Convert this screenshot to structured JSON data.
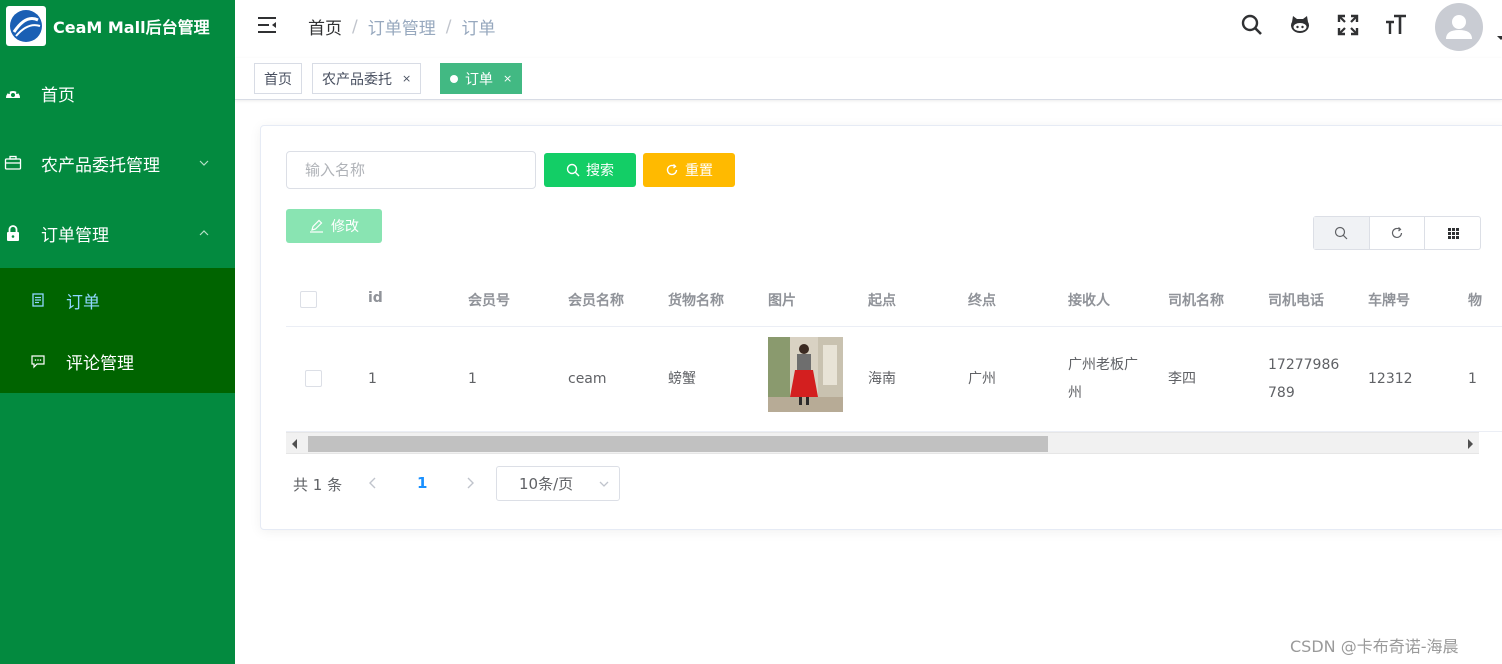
{
  "app": {
    "title": "CeaM Mall后台管理"
  },
  "sidebar": {
    "items": [
      {
        "label": "首页",
        "icon": "dashboard-icon"
      },
      {
        "label": "农产品委托管理",
        "icon": "briefcase-icon",
        "expanded": false
      },
      {
        "label": "订单管理",
        "icon": "lock-icon",
        "expanded": true
      }
    ],
    "submenu": [
      {
        "label": "订单",
        "icon": "document-icon",
        "active": true
      },
      {
        "label": "评论管理",
        "icon": "message-icon",
        "active": false
      }
    ]
  },
  "header": {
    "breadcrumb": [
      "首页",
      "订单管理",
      "订单"
    ],
    "separator": "/",
    "icons": [
      "search-icon",
      "github-icon",
      "fullscreen-icon",
      "font-size-icon",
      "avatar"
    ]
  },
  "tags": [
    {
      "label": "首页",
      "closable": false,
      "active": false
    },
    {
      "label": "农产品委托",
      "closable": true,
      "active": false
    },
    {
      "label": "订单",
      "closable": true,
      "active": true
    }
  ],
  "tag_close": "×",
  "toolbar": {
    "search_placeholder": "输入名称",
    "search_label": "搜索",
    "reset_label": "重置",
    "edit_label": "修改"
  },
  "table": {
    "headers": [
      "id",
      "会员号",
      "会员名称",
      "货物名称",
      "图片",
      "起点",
      "终点",
      "接收人",
      "司机名称",
      "司机电话",
      "车牌号",
      "物"
    ],
    "rows": [
      {
        "id": "1",
        "member_no": "1",
        "member_name": "ceam",
        "goods_name": "螃蟹",
        "start": "海南",
        "end": "广州",
        "receiver": "广州老板广州",
        "driver_name": "李四",
        "driver_phone": "17277986789",
        "plate": "12312",
        "extra": "1"
      }
    ]
  },
  "pagination": {
    "total_text": "共 1 条",
    "current_page": "1",
    "page_size": "10条/页"
  },
  "watermark": "CSDN @卡布奇诺-海晨",
  "colors": {
    "sidebar": "#038a3f",
    "submenu": "#006400",
    "active_tag": "#42b983",
    "search_button": "#13ce66",
    "reset_button": "#ffba00",
    "edit_button": "#89e4b2",
    "link": "#1890ff"
  }
}
